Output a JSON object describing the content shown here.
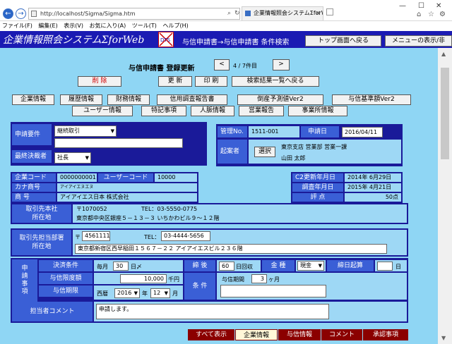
{
  "browser": {
    "url": "http://localhost/Sigma/Sigma.htm",
    "tab_title": "企業情報照会システムΣforWeb",
    "menu": [
      "ファイル(F)",
      "編集(E)",
      "表示(V)",
      "お気に入り(A)",
      "ツール(T)",
      "ヘルプ(H)"
    ]
  },
  "header": {
    "title": "企業情報照会システムΣforWeb",
    "logo_text": "DTS",
    "links": "与信申請書→与信申請書 条件検索",
    "top_button": "トップ画面へ戻る",
    "menu_button": "メニューの表示/非"
  },
  "form": {
    "heading": "与信申請書 登録更新",
    "prev": "<",
    "page": "4 / 7件目",
    "next": ">",
    "delete": "削 除",
    "update": "更 新",
    "print": "印 刷",
    "back_to_list": "検索結果一覧へ戻る"
  },
  "nav_tabs_row1": [
    "企業情報",
    "履歴情報",
    "財務情報",
    "信用調査報告書",
    "倒産予測値Ver2",
    "与信基準額Ver2"
  ],
  "nav_tabs_row2": [
    "ユーザー情報",
    "特記事項",
    "人脈情報",
    "営業報告",
    "事業所情報"
  ],
  "request": {
    "label_reason": "申請要件",
    "reason_value": "継続取引",
    "reason_text": "",
    "label_approver": "最終決裁者",
    "approver_value": "社長"
  },
  "manage": {
    "label_no": "管理No.",
    "no": "1511-001",
    "label_date": "申請日",
    "date": "2016/04/11",
    "label_applicant": "起案者",
    "select_button": "選択",
    "dept": "東京支店 営業部 営業一課",
    "name": "山田 太郎"
  },
  "company": {
    "label_code": "企業コード",
    "code": "0000000001",
    "label_user_code": "ユーザーコード",
    "user_code": "10000",
    "label_kana": "カナ商号",
    "kana": "アイアイエヌエヌ",
    "label_name": "商 号",
    "name": "アイアイエス日本 株式会社",
    "label_c2": "C2更新年月日",
    "c2_date": "2014年 6月29日",
    "label_survey": "調査年月日",
    "survey_date": "2015年 4月21日",
    "label_score": "評 点",
    "score": "50点"
  },
  "hq": {
    "label": "取引先本社\n所在地",
    "zip": "〒1070052",
    "tel": "TEL：03-5550-0775",
    "address": "東京都中央区銀座５－１３－３ いちかわビル９～１２階"
  },
  "branch": {
    "label": "取引先担当部署\n所在地",
    "zip_mark": "〒",
    "zip": "4561111",
    "tel_label": "TEL：",
    "tel": "03-4444-5656",
    "address": "東京都新宿区西早稲田１５６７－２２ アイアイエスビル２３６階"
  },
  "terms": {
    "side_label": "申請事項",
    "label_payment": "決済条件",
    "monthly": "毎月",
    "day": "30",
    "day_suffix": "日〆",
    "label_close": "締 後",
    "collect_day": "60",
    "collect_suffix": "日回収",
    "label_kind": "金 種",
    "kind": "現金",
    "label_start": "締日起算",
    "start_value": "",
    "start_suffix": "日",
    "label_limit": "与信限度額",
    "limit": "10,000",
    "limit_unit": "千円",
    "label_period": "与信期限",
    "era": "西暦",
    "year": "2016",
    "year_suffix": "年",
    "month": "12",
    "month_suffix": "月",
    "label_cond": "条 件",
    "label_term": "与信期間",
    "term": "3",
    "term_unit": "ヶ月",
    "cond_text": ""
  },
  "comment": {
    "label": "担当者コメント",
    "text": "申請します。"
  },
  "bottom_tabs": [
    "すべて表示",
    "企業情報",
    "与信情報",
    "コメント",
    "承認事項"
  ]
}
